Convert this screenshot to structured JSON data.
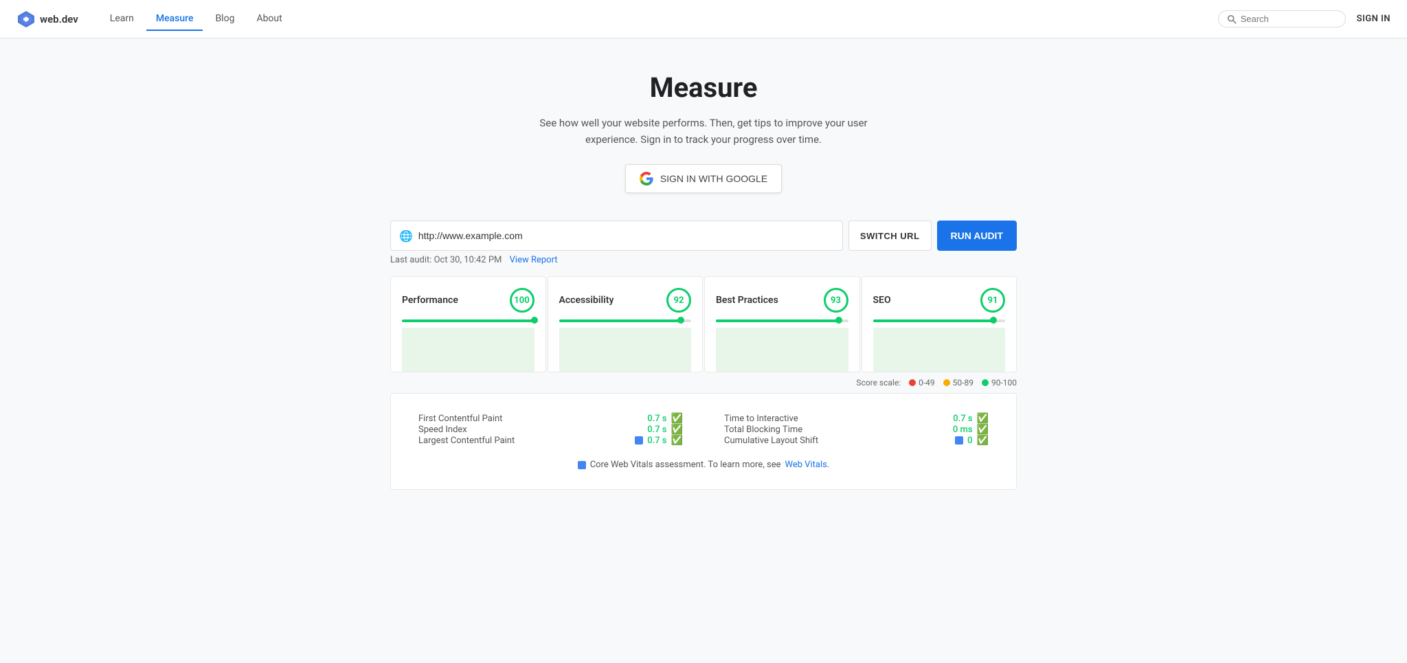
{
  "nav": {
    "logo_text": "web.dev",
    "links": [
      {
        "label": "Learn",
        "active": false
      },
      {
        "label": "Measure",
        "active": true
      },
      {
        "label": "Blog",
        "active": false
      },
      {
        "label": "About",
        "active": false
      }
    ],
    "search_placeholder": "Search",
    "sign_in_label": "SIGN IN"
  },
  "hero": {
    "title": "Measure",
    "subtitle": "See how well your website performs. Then, get tips to improve your user experience. Sign in to track your progress over time.",
    "sign_in_google_label": "SIGN IN WITH GOOGLE"
  },
  "url_section": {
    "url_value": "http://www.example.com",
    "url_placeholder": "Enter a web page URL",
    "switch_url_label": "SWITCH URL",
    "run_audit_label": "RUN AUDIT",
    "last_audit_text": "Last audit: Oct 30, 10:42 PM",
    "view_report_label": "View Report"
  },
  "scores": [
    {
      "label": "Performance",
      "value": 100,
      "bar_pct": 100
    },
    {
      "label": "Accessibility",
      "value": 92,
      "bar_pct": 92
    },
    {
      "label": "Best Practices",
      "value": 93,
      "bar_pct": 93
    },
    {
      "label": "SEO",
      "value": 91,
      "bar_pct": 91
    }
  ],
  "score_scale": {
    "label": "Score scale:",
    "items": [
      {
        "label": "0-49",
        "color": "#e94235"
      },
      {
        "label": "50-89",
        "color": "#f9ab00"
      },
      {
        "label": "90-100",
        "color": "#0cce6b"
      }
    ]
  },
  "metrics": {
    "left": [
      {
        "name": "First Contentful Paint",
        "value": "0.7 s",
        "has_badge": false
      },
      {
        "name": "Speed Index",
        "value": "0.7 s",
        "has_badge": false
      },
      {
        "name": "Largest Contentful Paint",
        "value": "0.7 s",
        "has_badge": true
      }
    ],
    "right": [
      {
        "name": "Time to Interactive",
        "value": "0.7 s",
        "has_badge": false
      },
      {
        "name": "Total Blocking Time",
        "value": "0 ms",
        "has_badge": false
      },
      {
        "name": "Cumulative Layout Shift",
        "value": "0",
        "has_badge": true
      }
    ]
  },
  "core_vitals_note": "Core Web Vitals assessment. To learn more, see",
  "web_vitals_link": "Web Vitals."
}
